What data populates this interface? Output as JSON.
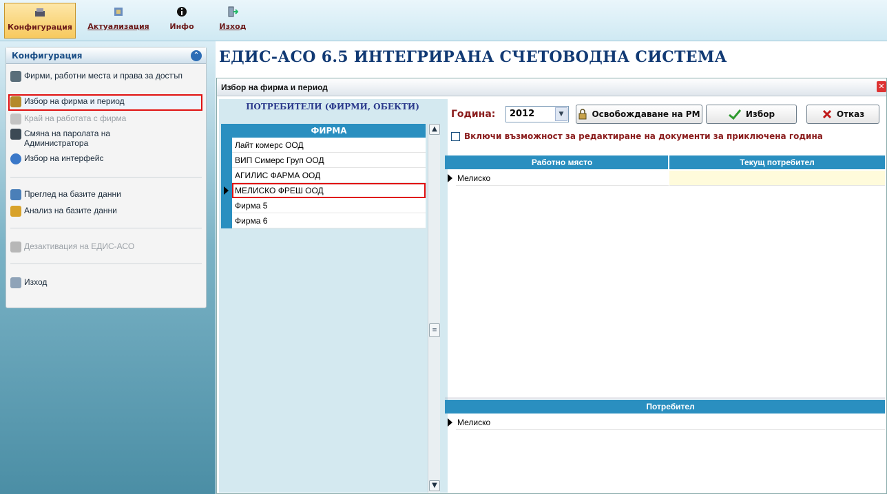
{
  "toolbar": {
    "items": [
      {
        "label": "Конфигурация"
      },
      {
        "label": "Актуализация"
      },
      {
        "label": "Инфо"
      },
      {
        "label": "Изход"
      }
    ]
  },
  "sidebar": {
    "title": "Конфигурация",
    "items": [
      {
        "label": "Фирми, работни места и права за достъп",
        "icon": "users-key-icon"
      },
      {
        "label": "Избор на фирма и период",
        "icon": "lock-icon"
      },
      {
        "label": "Край на работата с фирма",
        "icon": "lock-disabled-icon"
      },
      {
        "label": "Смяна на паролата на Администратора",
        "icon": "password-icon"
      },
      {
        "label": "Избор на интерфейс",
        "icon": "globe-icon"
      },
      {
        "label": "Преглед на базите данни",
        "icon": "database-icon"
      },
      {
        "label": "Анализ на базите данни",
        "icon": "analyze-icon"
      },
      {
        "label": "Дезактивация на ЕДИС-АСО",
        "icon": "deactivate-icon"
      },
      {
        "label": "Изход",
        "icon": "exit-icon"
      }
    ]
  },
  "app_title": "ЕДИС-АСО 6.5  ИНТЕГРИРАНА СЧЕТОВОДНА СИСТЕМА",
  "dialog": {
    "title": "Избор на фирма и период",
    "firms_heading": "ПОТРЕБИТЕЛИ (ФИРМИ, ОБЕКТИ)",
    "firms_column": "ФИРМА",
    "firms": [
      "Лайт комерс ООД",
      "ВИП Симерс Груп ООД",
      "АГИЛИС ФАРМА ООД",
      "МЕЛИСКО ФРЕШ ООД",
      "Фирма 5",
      "Фирма 6"
    ],
    "year_label": "Година:",
    "year_value": "2012",
    "release_button": "Освобождаване на РМ",
    "select_button": "Избор",
    "cancel_button": "Отказ",
    "checkbox_label": "Включи възможност за редактиране на документи за приключена година",
    "workstations": {
      "columns": [
        "Работно място",
        "Текущ потребител"
      ],
      "rows": [
        [
          "Мелиско",
          ""
        ]
      ]
    },
    "users": {
      "columns": [
        "Потребител"
      ],
      "rows": [
        [
          "Мелиско"
        ]
      ]
    }
  },
  "colors": {
    "grid_header": "#2a8fc0",
    "title": "#123a74",
    "label": "#8a1c1c"
  }
}
